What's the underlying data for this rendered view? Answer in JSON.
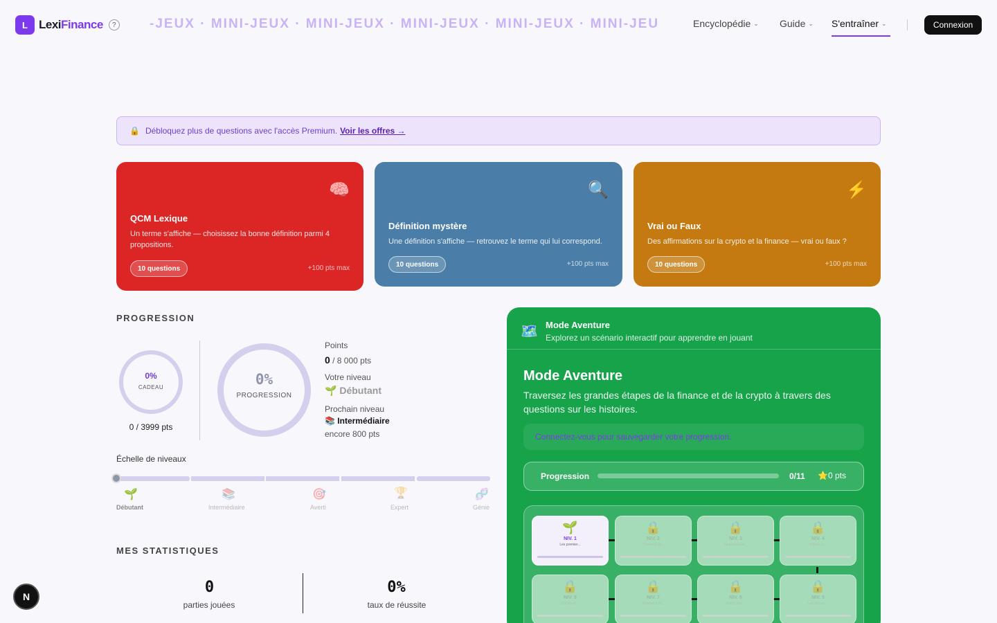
{
  "nav": {
    "logo_letter": "L",
    "brand_a": "Lexi",
    "brand_b": "Finance",
    "help": "?",
    "marquee": "-JEUX · MINI-JEUX · MINI-JEUX · MINI-JEUX · MINI-JEUX · MINI-JEUX",
    "menu": [
      "Encyclopédie",
      "Guide",
      "S'entraîner"
    ],
    "login": "Connexion"
  },
  "banner": {
    "text": "Débloquez plus de questions avec l'accès Premium.",
    "link": "Voir les offres →"
  },
  "games": [
    {
      "icon": "brain-icon",
      "emoji": "🧠",
      "title": "QCM Lexique",
      "desc": "Un terme s'affiche — choisissez la bonne définition parmi 4 propositions.",
      "pill": "10 questions",
      "pts": "+100 pts max",
      "color": "#dc2626"
    },
    {
      "icon": "magnifier-icon",
      "emoji": "🔍",
      "title": "Définition mystère",
      "desc": "Une définition s'affiche — retrouvez le terme qui lui correspond.",
      "pill": "10 questions",
      "pts": "+100 pts max",
      "color": "#4a7ea8"
    },
    {
      "icon": "lightning-icon",
      "emoji": "⚡",
      "title": "Vrai ou Faux",
      "desc": "Des affirmations sur la crypto et la finance — vrai ou faux ?",
      "pill": "10 questions",
      "pts": "+100 pts max",
      "color": "#c47a10"
    }
  ],
  "progression": {
    "heading": "PROGRESSION",
    "gift_pct": "0%",
    "gift_label": "CADEAU",
    "gift_pts": "0 / 3999 pts",
    "main_pct": "0%",
    "main_label": "PROGRESSION",
    "points_label": "Points",
    "points_value": "0",
    "points_total": " / 8 000 pts",
    "level_label": "Votre niveau",
    "level_value": "Débutant",
    "next_label": "Prochain niveau",
    "next_value": "Intermédiaire",
    "next_remaining": "encore 800 pts",
    "scale_label": "Échelle de niveaux",
    "scale_progress": 0,
    "levels": [
      {
        "icon": "seedling-icon",
        "emoji": "🌱",
        "name": "Débutant"
      },
      {
        "icon": "books-icon",
        "emoji": "📚",
        "name": "Intermédiaire"
      },
      {
        "icon": "target-icon",
        "emoji": "🎯",
        "name": "Averti"
      },
      {
        "icon": "trophy-icon",
        "emoji": "🏆",
        "name": "Expert"
      },
      {
        "icon": "dna-icon",
        "emoji": "🧬",
        "name": "Génie"
      }
    ]
  },
  "stats": {
    "heading": "MES STATISTIQUES",
    "played": "0",
    "played_label": "parties jouées",
    "rate": "0%",
    "rate_label": "taux de réussite"
  },
  "adventure": {
    "header_title": "Mode Aventure",
    "header_sub": "Explorez un scénario interactif pour apprendre en jouant",
    "title": "Mode Aventure",
    "desc": "Traversez les grandes étapes de la finance et de la crypto à travers des questions sur les histoires.",
    "connect": "Connectez-vous pour sauvegarder votre progression.",
    "progress_label": "Progression",
    "progress_count": "0/11",
    "progress_value": 0,
    "stars": "0 pts",
    "levels": [
      {
        "label": "NIV. 1",
        "sub": "Les premier..."
      },
      {
        "label": "NIV. 2",
        "sub": "Premiers te..."
      },
      {
        "label": "NIV. 3",
        "sub": "La naissance..."
      },
      {
        "label": "NIV. 4",
        "sub": "Bitcoin et..."
      },
      {
        "label": "NIV. 9",
        "sub": "Bitcoin et..."
      },
      {
        "label": "NIV. 7",
        "sub": "Ethereum et..."
      },
      {
        "label": "NIV. 6",
        "sub": "Boom des..."
      },
      {
        "label": "NIV. 5",
        "sub": "Les Bitcoin..."
      }
    ]
  },
  "fab": "N"
}
